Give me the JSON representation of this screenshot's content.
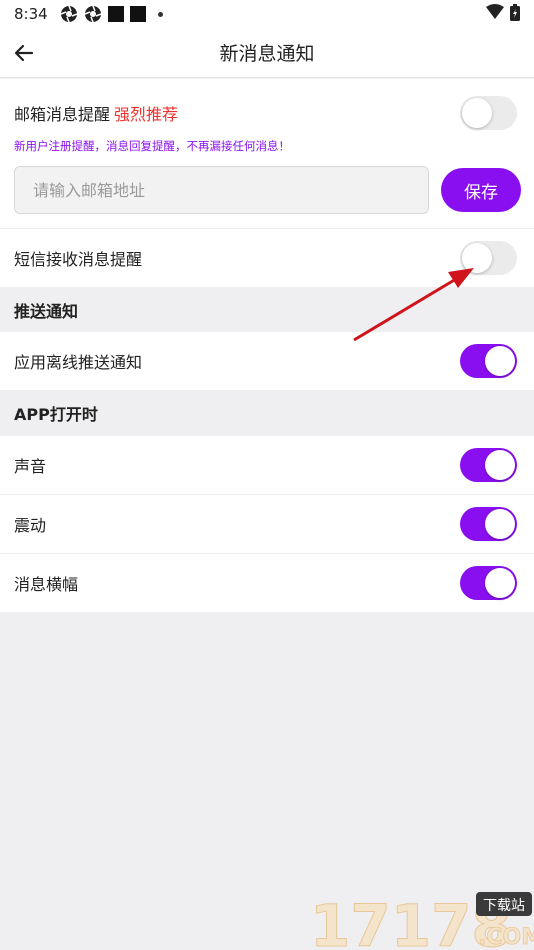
{
  "status_bar": {
    "time": "8:34"
  },
  "header": {
    "title": "新消息通知",
    "back_icon": "arrow-left-icon"
  },
  "email_alert": {
    "label": "邮箱消息提醒",
    "recommend": "强烈推荐",
    "hint": "新用户注册提醒，消息回复提醒，不再漏接任何消息！",
    "enabled": false,
    "input_value": "",
    "input_placeholder": "请输入邮箱地址",
    "save_label": "保存"
  },
  "sms_alert": {
    "label": "短信接收消息提醒",
    "enabled": false
  },
  "push_section": {
    "title": "推送通知",
    "items": [
      {
        "label": "应用离线推送通知",
        "enabled": true
      }
    ]
  },
  "app_open_section": {
    "title": "APP打开时",
    "items": [
      {
        "label": "声音",
        "enabled": true
      },
      {
        "label": "震动",
        "enabled": true
      },
      {
        "label": "消息横幅",
        "enabled": true
      }
    ]
  },
  "watermark": {
    "number": "17178",
    "site": "下载站",
    "domain": ".COM"
  },
  "colors": {
    "accent": "#8a0ff0",
    "recommend": "#f0322e",
    "annotation_arrow": "#d0141c"
  }
}
